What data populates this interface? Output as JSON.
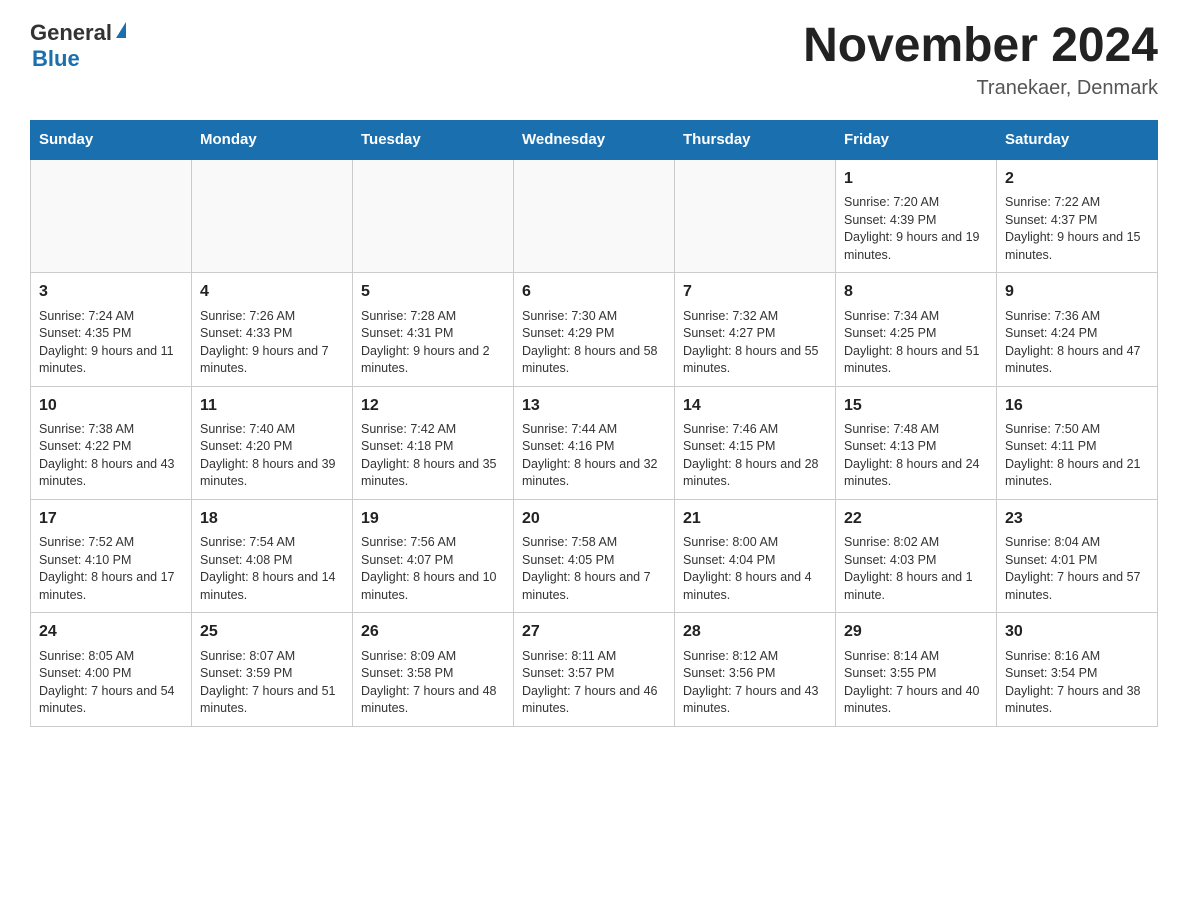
{
  "logo": {
    "text_general": "General",
    "text_blue": "Blue",
    "arrow": "▲"
  },
  "title": "November 2024",
  "subtitle": "Tranekaer, Denmark",
  "days_of_week": [
    "Sunday",
    "Monday",
    "Tuesday",
    "Wednesday",
    "Thursday",
    "Friday",
    "Saturday"
  ],
  "weeks": [
    [
      {
        "day": "",
        "info": ""
      },
      {
        "day": "",
        "info": ""
      },
      {
        "day": "",
        "info": ""
      },
      {
        "day": "",
        "info": ""
      },
      {
        "day": "",
        "info": ""
      },
      {
        "day": "1",
        "info": "Sunrise: 7:20 AM\nSunset: 4:39 PM\nDaylight: 9 hours and 19 minutes."
      },
      {
        "day": "2",
        "info": "Sunrise: 7:22 AM\nSunset: 4:37 PM\nDaylight: 9 hours and 15 minutes."
      }
    ],
    [
      {
        "day": "3",
        "info": "Sunrise: 7:24 AM\nSunset: 4:35 PM\nDaylight: 9 hours and 11 minutes."
      },
      {
        "day": "4",
        "info": "Sunrise: 7:26 AM\nSunset: 4:33 PM\nDaylight: 9 hours and 7 minutes."
      },
      {
        "day": "5",
        "info": "Sunrise: 7:28 AM\nSunset: 4:31 PM\nDaylight: 9 hours and 2 minutes."
      },
      {
        "day": "6",
        "info": "Sunrise: 7:30 AM\nSunset: 4:29 PM\nDaylight: 8 hours and 58 minutes."
      },
      {
        "day": "7",
        "info": "Sunrise: 7:32 AM\nSunset: 4:27 PM\nDaylight: 8 hours and 55 minutes."
      },
      {
        "day": "8",
        "info": "Sunrise: 7:34 AM\nSunset: 4:25 PM\nDaylight: 8 hours and 51 minutes."
      },
      {
        "day": "9",
        "info": "Sunrise: 7:36 AM\nSunset: 4:24 PM\nDaylight: 8 hours and 47 minutes."
      }
    ],
    [
      {
        "day": "10",
        "info": "Sunrise: 7:38 AM\nSunset: 4:22 PM\nDaylight: 8 hours and 43 minutes."
      },
      {
        "day": "11",
        "info": "Sunrise: 7:40 AM\nSunset: 4:20 PM\nDaylight: 8 hours and 39 minutes."
      },
      {
        "day": "12",
        "info": "Sunrise: 7:42 AM\nSunset: 4:18 PM\nDaylight: 8 hours and 35 minutes."
      },
      {
        "day": "13",
        "info": "Sunrise: 7:44 AM\nSunset: 4:16 PM\nDaylight: 8 hours and 32 minutes."
      },
      {
        "day": "14",
        "info": "Sunrise: 7:46 AM\nSunset: 4:15 PM\nDaylight: 8 hours and 28 minutes."
      },
      {
        "day": "15",
        "info": "Sunrise: 7:48 AM\nSunset: 4:13 PM\nDaylight: 8 hours and 24 minutes."
      },
      {
        "day": "16",
        "info": "Sunrise: 7:50 AM\nSunset: 4:11 PM\nDaylight: 8 hours and 21 minutes."
      }
    ],
    [
      {
        "day": "17",
        "info": "Sunrise: 7:52 AM\nSunset: 4:10 PM\nDaylight: 8 hours and 17 minutes."
      },
      {
        "day": "18",
        "info": "Sunrise: 7:54 AM\nSunset: 4:08 PM\nDaylight: 8 hours and 14 minutes."
      },
      {
        "day": "19",
        "info": "Sunrise: 7:56 AM\nSunset: 4:07 PM\nDaylight: 8 hours and 10 minutes."
      },
      {
        "day": "20",
        "info": "Sunrise: 7:58 AM\nSunset: 4:05 PM\nDaylight: 8 hours and 7 minutes."
      },
      {
        "day": "21",
        "info": "Sunrise: 8:00 AM\nSunset: 4:04 PM\nDaylight: 8 hours and 4 minutes."
      },
      {
        "day": "22",
        "info": "Sunrise: 8:02 AM\nSunset: 4:03 PM\nDaylight: 8 hours and 1 minute."
      },
      {
        "day": "23",
        "info": "Sunrise: 8:04 AM\nSunset: 4:01 PM\nDaylight: 7 hours and 57 minutes."
      }
    ],
    [
      {
        "day": "24",
        "info": "Sunrise: 8:05 AM\nSunset: 4:00 PM\nDaylight: 7 hours and 54 minutes."
      },
      {
        "day": "25",
        "info": "Sunrise: 8:07 AM\nSunset: 3:59 PM\nDaylight: 7 hours and 51 minutes."
      },
      {
        "day": "26",
        "info": "Sunrise: 8:09 AM\nSunset: 3:58 PM\nDaylight: 7 hours and 48 minutes."
      },
      {
        "day": "27",
        "info": "Sunrise: 8:11 AM\nSunset: 3:57 PM\nDaylight: 7 hours and 46 minutes."
      },
      {
        "day": "28",
        "info": "Sunrise: 8:12 AM\nSunset: 3:56 PM\nDaylight: 7 hours and 43 minutes."
      },
      {
        "day": "29",
        "info": "Sunrise: 8:14 AM\nSunset: 3:55 PM\nDaylight: 7 hours and 40 minutes."
      },
      {
        "day": "30",
        "info": "Sunrise: 8:16 AM\nSunset: 3:54 PM\nDaylight: 7 hours and 38 minutes."
      }
    ]
  ]
}
